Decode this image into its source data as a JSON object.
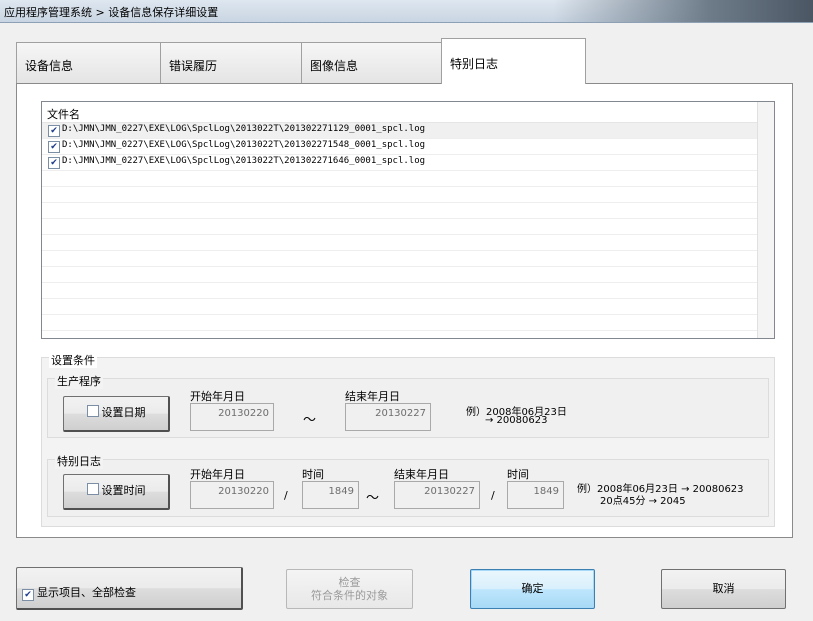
{
  "window": {
    "title": "应用程序管理系统 > 设备信息保存详细设置"
  },
  "tabs": [
    {
      "label": "设备信息"
    },
    {
      "label": "错误履历"
    },
    {
      "label": "图像信息"
    },
    {
      "label": "特别日志"
    }
  ],
  "file_list": {
    "column_header": "文件名",
    "rows": [
      {
        "checked": true,
        "filename": "D:\\JMN\\JMN_0227\\EXE\\LOG\\SpclLog\\2013022T\\201302271129_0001_spcl.log"
      },
      {
        "checked": true,
        "filename": "D:\\JMN\\JMN_0227\\EXE\\LOG\\SpclLog\\2013022T\\201302271548_0001_spcl.log"
      },
      {
        "checked": true,
        "filename": "D:\\JMN\\JMN_0227\\EXE\\LOG\\SpclLog\\2013022T\\201302271646_0001_spcl.log"
      }
    ]
  },
  "conditions": {
    "title": "设置条件",
    "production": {
      "title": "生产程序",
      "button_label": "设置日期",
      "start_label": "开始年月日",
      "start_value": "20130220",
      "tilde": "～",
      "end_label": "结束年月日",
      "end_value": "20130227",
      "example_line1": "例）2008年06月23日",
      "example_line2": "→ 20080623"
    },
    "special_log": {
      "title": "特别日志",
      "button_label": "设置时间",
      "start_label": "开始年月日",
      "start_value": "20130220",
      "time_label_1": "时间",
      "time_value_1": "1849",
      "slash": "/",
      "tilde": "～",
      "end_label": "结束年月日",
      "end_value": "20130227",
      "time_label_2": "时间",
      "time_value_2": "1849",
      "example_line1": "例）2008年06月23日 → 20080623",
      "example_line2": "20点45分 → 2045"
    }
  },
  "footer": {
    "show_items_label": "显示项目、全部检查",
    "check_label_1": "检查",
    "check_label_2": "符合条件的对象",
    "ok_label": "确定",
    "cancel_label": "取消"
  },
  "colors": {
    "primary_button": "#bee6fd",
    "checkbox": "#1a3a8a"
  }
}
